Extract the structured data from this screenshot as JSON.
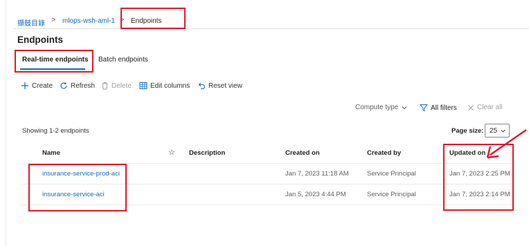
{
  "breadcrumb": {
    "items": [
      "擷鼓目錄",
      "mlops-wsh-aml-1",
      "Endpoints"
    ],
    "separator": ">"
  },
  "page": {
    "title": "Endpoints"
  },
  "tabs": {
    "realtime": "Real-time endpoints",
    "batch": "Batch endpoints"
  },
  "toolbar": {
    "create": "Create",
    "refresh": "Refresh",
    "delete": "Delete",
    "edit_columns": "Edit columns",
    "reset_view": "Reset view"
  },
  "filters": {
    "compute_type": "Compute type",
    "all_filters": "All filters",
    "clear_all": "Clear all"
  },
  "list": {
    "showing": "Showing 1-2 endpoints",
    "page_size_label": "Page size:",
    "page_size_value": "25"
  },
  "table": {
    "columns": {
      "name": "Name",
      "star": "☆",
      "description": "Description",
      "created_on": "Created on",
      "created_by": "Created by",
      "updated_on": "Updated on"
    },
    "sort_indicator": "↓",
    "rows": [
      {
        "name": "insurance-service-prod-aci",
        "description": "",
        "created_on": "Jan 7, 2023 11:18 AM",
        "created_by": "Service Principal",
        "updated_on": "Jan 7, 2023 2:25 PM"
      },
      {
        "name": "insurance-service-aci",
        "description": "",
        "created_on": "Jan 5, 2023 4:44 PM",
        "created_by": "Service Principal",
        "updated_on": "Jan 7, 2023 2:14 PM"
      }
    ]
  },
  "colors": {
    "accent": "#0f6cbd",
    "highlight": "#e3172b"
  }
}
